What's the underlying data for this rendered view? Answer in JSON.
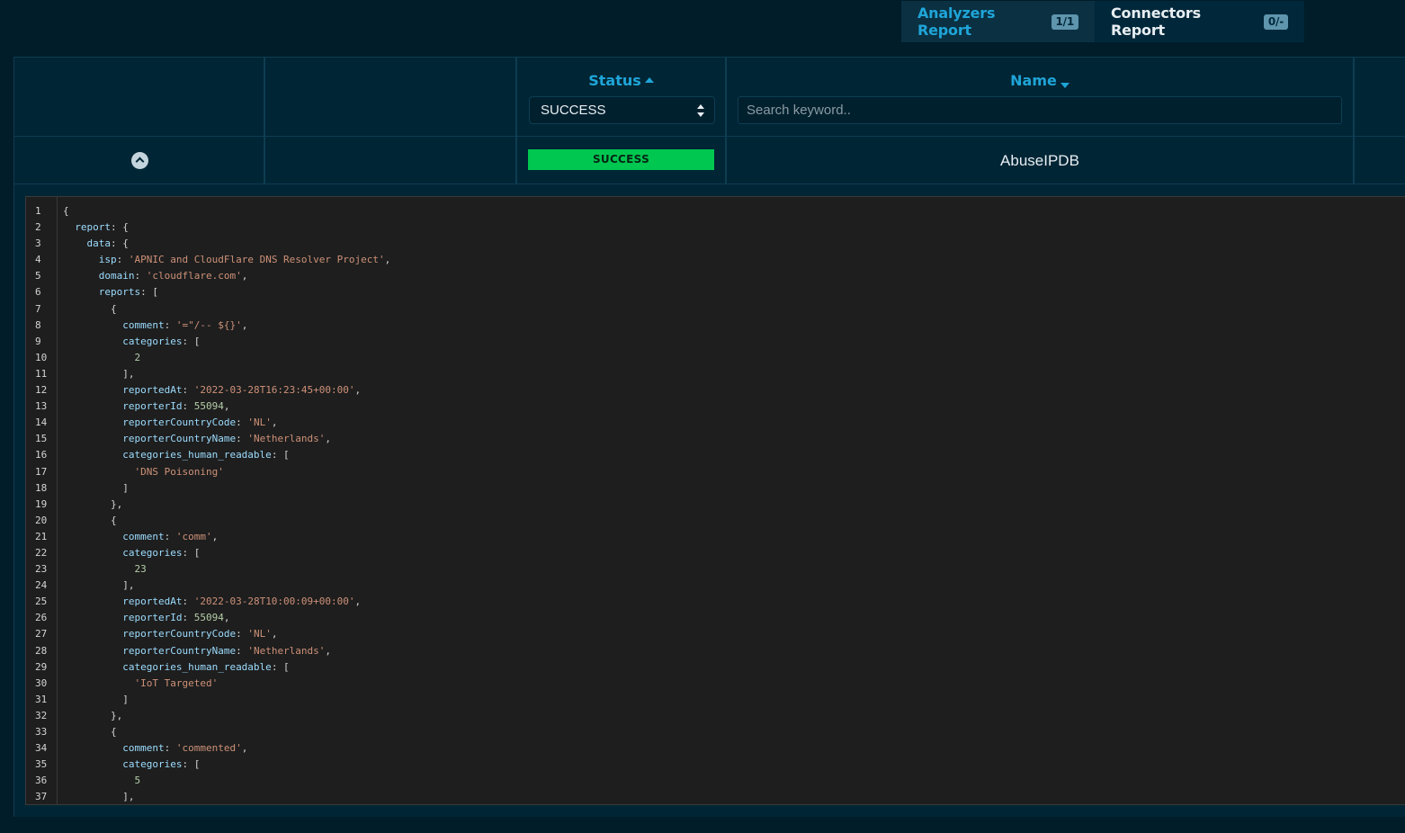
{
  "tabs": [
    {
      "label": "Analyzers Report",
      "badge": "1/1",
      "active": true
    },
    {
      "label": "Connectors Report",
      "badge": "0/-",
      "active": false
    }
  ],
  "columns": {
    "status": {
      "title": "Status",
      "filter_value": "SUCCESS"
    },
    "name": {
      "title": "Name",
      "search_placeholder": "Search keyword.."
    }
  },
  "row": {
    "status": "SUCCESS",
    "name": "AbuseIPDB"
  },
  "colors": {
    "background": "#001d29",
    "accent": "#1fa5d8",
    "success": "#00c750",
    "editor_bg": "#1e1e1e"
  },
  "code_lines": [
    [
      [
        "p",
        "{"
      ]
    ],
    [
      [
        "p",
        "  "
      ],
      [
        "k",
        "report"
      ],
      [
        "p",
        ": {"
      ]
    ],
    [
      [
        "p",
        "    "
      ],
      [
        "k",
        "data"
      ],
      [
        "p",
        ": {"
      ]
    ],
    [
      [
        "p",
        "      "
      ],
      [
        "k",
        "isp"
      ],
      [
        "p",
        ": "
      ],
      [
        "s",
        "'APNIC and CloudFlare DNS Resolver Project'"
      ],
      [
        "p",
        ","
      ]
    ],
    [
      [
        "p",
        "      "
      ],
      [
        "k",
        "domain"
      ],
      [
        "p",
        ": "
      ],
      [
        "s",
        "'cloudflare.com'"
      ],
      [
        "p",
        ","
      ]
    ],
    [
      [
        "p",
        "      "
      ],
      [
        "k",
        "reports"
      ],
      [
        "p",
        ": ["
      ]
    ],
    [
      [
        "p",
        "        {"
      ]
    ],
    [
      [
        "p",
        "          "
      ],
      [
        "k",
        "comment"
      ],
      [
        "p",
        ": "
      ],
      [
        "s",
        "'=\"/-- ${}'"
      ],
      [
        "p",
        ","
      ]
    ],
    [
      [
        "p",
        "          "
      ],
      [
        "k",
        "categories"
      ],
      [
        "p",
        ": ["
      ]
    ],
    [
      [
        "p",
        "            "
      ],
      [
        "n",
        "2"
      ]
    ],
    [
      [
        "p",
        "          ],"
      ]
    ],
    [
      [
        "p",
        "          "
      ],
      [
        "k",
        "reportedAt"
      ],
      [
        "p",
        ": "
      ],
      [
        "s",
        "'2022-03-28T16:23:45+00:00'"
      ],
      [
        "p",
        ","
      ]
    ],
    [
      [
        "p",
        "          "
      ],
      [
        "k",
        "reporterId"
      ],
      [
        "p",
        ": "
      ],
      [
        "n",
        "55094"
      ],
      [
        "p",
        ","
      ]
    ],
    [
      [
        "p",
        "          "
      ],
      [
        "k",
        "reporterCountryCode"
      ],
      [
        "p",
        ": "
      ],
      [
        "s",
        "'NL'"
      ],
      [
        "p",
        ","
      ]
    ],
    [
      [
        "p",
        "          "
      ],
      [
        "k",
        "reporterCountryName"
      ],
      [
        "p",
        ": "
      ],
      [
        "s",
        "'Netherlands'"
      ],
      [
        "p",
        ","
      ]
    ],
    [
      [
        "p",
        "          "
      ],
      [
        "k",
        "categories_human_readable"
      ],
      [
        "p",
        ": ["
      ]
    ],
    [
      [
        "p",
        "            "
      ],
      [
        "s",
        "'DNS Poisoning'"
      ]
    ],
    [
      [
        "p",
        "          ]"
      ]
    ],
    [
      [
        "p",
        "        },"
      ]
    ],
    [
      [
        "p",
        "        {"
      ]
    ],
    [
      [
        "p",
        "          "
      ],
      [
        "k",
        "comment"
      ],
      [
        "p",
        ": "
      ],
      [
        "s",
        "'comm'"
      ],
      [
        "p",
        ","
      ]
    ],
    [
      [
        "p",
        "          "
      ],
      [
        "k",
        "categories"
      ],
      [
        "p",
        ": ["
      ]
    ],
    [
      [
        "p",
        "            "
      ],
      [
        "n",
        "23"
      ]
    ],
    [
      [
        "p",
        "          ],"
      ]
    ],
    [
      [
        "p",
        "          "
      ],
      [
        "k",
        "reportedAt"
      ],
      [
        "p",
        ": "
      ],
      [
        "s",
        "'2022-03-28T10:00:09+00:00'"
      ],
      [
        "p",
        ","
      ]
    ],
    [
      [
        "p",
        "          "
      ],
      [
        "k",
        "reporterId"
      ],
      [
        "p",
        ": "
      ],
      [
        "n",
        "55094"
      ],
      [
        "p",
        ","
      ]
    ],
    [
      [
        "p",
        "          "
      ],
      [
        "k",
        "reporterCountryCode"
      ],
      [
        "p",
        ": "
      ],
      [
        "s",
        "'NL'"
      ],
      [
        "p",
        ","
      ]
    ],
    [
      [
        "p",
        "          "
      ],
      [
        "k",
        "reporterCountryName"
      ],
      [
        "p",
        ": "
      ],
      [
        "s",
        "'Netherlands'"
      ],
      [
        "p",
        ","
      ]
    ],
    [
      [
        "p",
        "          "
      ],
      [
        "k",
        "categories_human_readable"
      ],
      [
        "p",
        ": ["
      ]
    ],
    [
      [
        "p",
        "            "
      ],
      [
        "s",
        "'IoT Targeted'"
      ]
    ],
    [
      [
        "p",
        "          ]"
      ]
    ],
    [
      [
        "p",
        "        },"
      ]
    ],
    [
      [
        "p",
        "        {"
      ]
    ],
    [
      [
        "p",
        "          "
      ],
      [
        "k",
        "comment"
      ],
      [
        "p",
        ": "
      ],
      [
        "s",
        "'commented'"
      ],
      [
        "p",
        ","
      ]
    ],
    [
      [
        "p",
        "          "
      ],
      [
        "k",
        "categories"
      ],
      [
        "p",
        ": ["
      ]
    ],
    [
      [
        "p",
        "            "
      ],
      [
        "n",
        "5"
      ]
    ],
    [
      [
        "p",
        "          ],"
      ]
    ]
  ]
}
